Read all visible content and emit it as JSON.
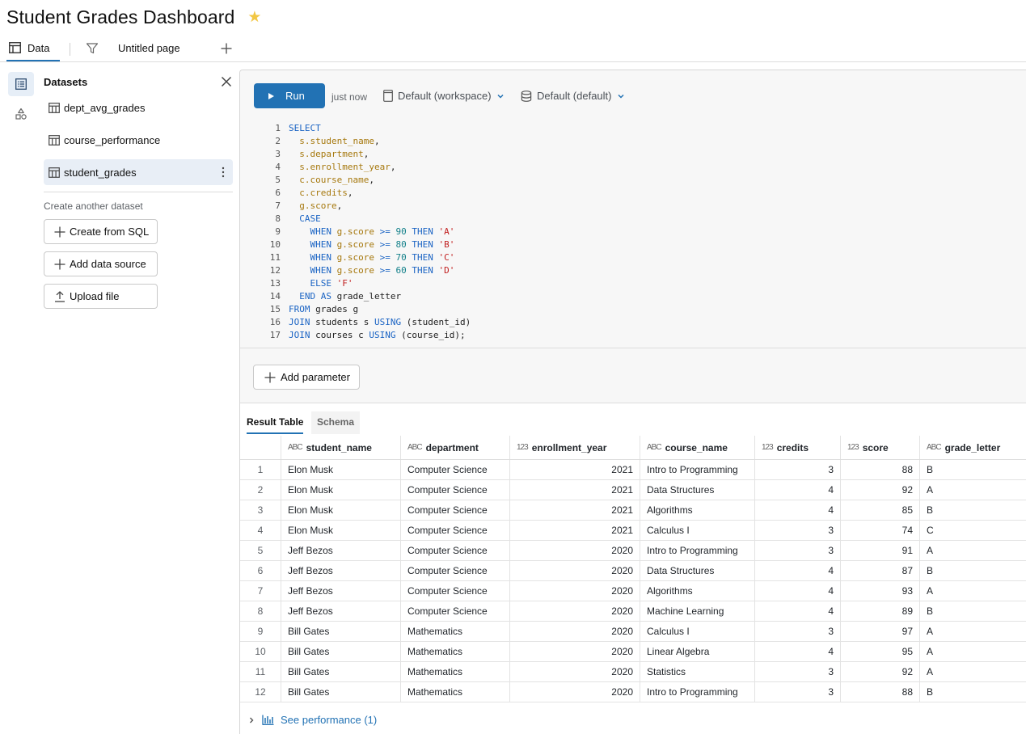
{
  "header": {
    "title": "Student Grades Dashboard"
  },
  "tabs": {
    "data_label": "Data",
    "page_label": "Untitled page"
  },
  "datasets": {
    "title": "Datasets",
    "items": [
      {
        "label": "dept_avg_grades"
      },
      {
        "label": "course_performance"
      },
      {
        "label": "student_grades"
      }
    ],
    "create_label": "Create another dataset",
    "buttons": {
      "create_sql": "Create from SQL",
      "add_source": "Add data source",
      "upload": "Upload file"
    }
  },
  "toolbar": {
    "run_label": "Run",
    "last_run": "just now",
    "catalog": "Default (workspace)",
    "schema": "Default (default)"
  },
  "editor": {
    "line_numbers": [
      "1",
      "2",
      "3",
      "4",
      "5",
      "6",
      "7",
      "8",
      "9",
      "10",
      "11",
      "12",
      "13",
      "14",
      "15",
      "16",
      "17"
    ]
  },
  "params": {
    "add_label": "Add parameter"
  },
  "results": {
    "tab_result": "Result Table",
    "tab_schema": "Schema",
    "type_text": "ABC",
    "type_num": "123",
    "columns": [
      "student_name",
      "department",
      "enrollment_year",
      "course_name",
      "credits",
      "score",
      "grade_letter"
    ],
    "rows": [
      [
        "1",
        "Elon Musk",
        "Computer Science",
        "2021",
        "Intro to Programming",
        "3",
        "88",
        "B"
      ],
      [
        "2",
        "Elon Musk",
        "Computer Science",
        "2021",
        "Data Structures",
        "4",
        "92",
        "A"
      ],
      [
        "3",
        "Elon Musk",
        "Computer Science",
        "2021",
        "Algorithms",
        "4",
        "85",
        "B"
      ],
      [
        "4",
        "Elon Musk",
        "Computer Science",
        "2021",
        "Calculus I",
        "3",
        "74",
        "C"
      ],
      [
        "5",
        "Jeff Bezos",
        "Computer Science",
        "2020",
        "Intro to Programming",
        "3",
        "91",
        "A"
      ],
      [
        "6",
        "Jeff Bezos",
        "Computer Science",
        "2020",
        "Data Structures",
        "4",
        "87",
        "B"
      ],
      [
        "7",
        "Jeff Bezos",
        "Computer Science",
        "2020",
        "Algorithms",
        "4",
        "93",
        "A"
      ],
      [
        "8",
        "Jeff Bezos",
        "Computer Science",
        "2020",
        "Machine Learning",
        "4",
        "89",
        "B"
      ],
      [
        "9",
        "Bill Gates",
        "Mathematics",
        "2020",
        "Calculus I",
        "3",
        "97",
        "A"
      ],
      [
        "10",
        "Bill Gates",
        "Mathematics",
        "2020",
        "Linear Algebra",
        "4",
        "95",
        "A"
      ],
      [
        "11",
        "Bill Gates",
        "Mathematics",
        "2020",
        "Statistics",
        "3",
        "92",
        "A"
      ],
      [
        "12",
        "Bill Gates",
        "Mathematics",
        "2020",
        "Intro to Programming",
        "3",
        "88",
        "B"
      ]
    ]
  },
  "footer": {
    "perf_label": "See performance (1)"
  },
  "colors": {
    "accent": "#2272b4",
    "star": "#f2c744",
    "keyword": "#1b64c4",
    "identifier": "#a6780d",
    "number": "#13808a",
    "string": "#c22121"
  }
}
